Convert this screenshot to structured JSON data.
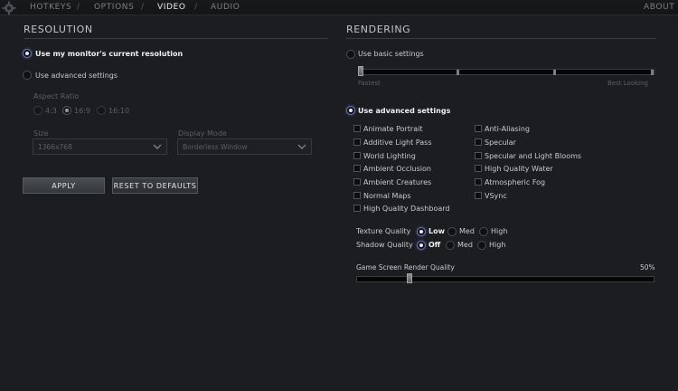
{
  "nav": {
    "tabs": [
      {
        "label": "HOTKEYS"
      },
      {
        "label": "OPTIONS"
      },
      {
        "label": "VIDEO"
      },
      {
        "label": "AUDIO"
      }
    ],
    "separator": "/",
    "about": "ABOUT",
    "active_tab": "VIDEO"
  },
  "resolution": {
    "title": "RESOLUTION",
    "use_monitor": "Use my monitor's current resolution",
    "use_advanced": "Use advanced settings",
    "selected": "use_monitor",
    "aspect_ratio_label": "Aspect Ratio",
    "aspect_options": [
      "4:3",
      "16:9",
      "16:10"
    ],
    "aspect_selected": "16:9",
    "size_label": "Size",
    "size_value": "1366x768",
    "display_mode_label": "Display Mode",
    "display_mode_value": "Borderless Window",
    "apply_label": "APPLY",
    "reset_label": "RESET TO DEFAULTS"
  },
  "rendering": {
    "title": "RENDERING",
    "use_basic": "Use basic settings",
    "slider_min_label": "Fastest",
    "slider_max_label": "Best Looking",
    "use_advanced": "Use advanced settings",
    "selected": "use_advanced",
    "checkboxes_left": [
      "Animate Portrait",
      "Additive Light Pass",
      "World Lighting",
      "Ambient Occlusion",
      "Ambient Creatures",
      "Normal Maps",
      "High Quality Dashboard"
    ],
    "checkboxes_right": [
      "Anti-Aliasing",
      "Specular",
      "Specular and Light Blooms",
      "High Quality Water",
      "Atmospheric Fog",
      "VSync"
    ],
    "texture_quality_label": "Texture Quality",
    "texture_options": [
      "Low",
      "Med",
      "High"
    ],
    "texture_selected": "Low",
    "shadow_quality_label": "Shadow Quality",
    "shadow_options": [
      "Off",
      "Med",
      "High"
    ],
    "shadow_selected": "Off",
    "render_quality_label": "Game Screen Render Quality",
    "render_quality_value": "50%",
    "render_quality_fraction": 0.17
  },
  "colors": {
    "background": "#1b1d20",
    "accent_radio": "#6a72a8"
  }
}
